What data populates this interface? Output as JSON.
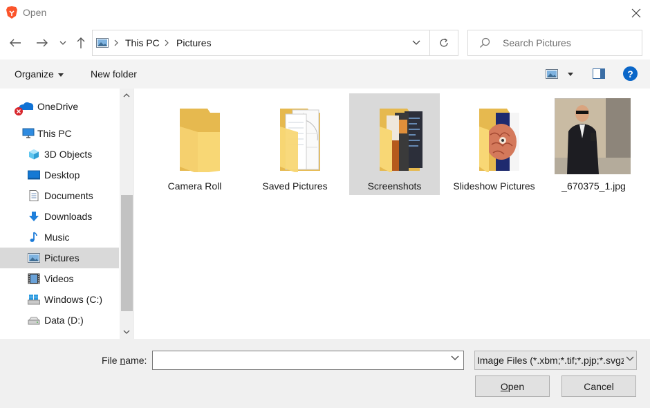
{
  "window": {
    "title": "Open",
    "close_icon": "close-icon",
    "app_icon": "brave-lion-icon"
  },
  "nav": {
    "back_icon": "arrow-left-icon",
    "forward_icon": "arrow-right-icon",
    "recent_icon": "chevron-down-icon",
    "up_icon": "arrow-up-icon",
    "breadcrumb": [
      "This PC",
      "Pictures"
    ],
    "refresh_icon": "refresh-icon",
    "search_placeholder": "Search Pictures"
  },
  "toolbar": {
    "organize": "Organize",
    "new_folder": "New folder",
    "help": "?"
  },
  "sidebar": {
    "items": [
      {
        "label": "OneDrive",
        "icon": "onedrive-error-icon"
      },
      {
        "label": "This PC",
        "icon": "computer-icon"
      },
      {
        "label": "3D Objects",
        "icon": "3d-objects-icon"
      },
      {
        "label": "Desktop",
        "icon": "desktop-icon"
      },
      {
        "label": "Documents",
        "icon": "documents-icon"
      },
      {
        "label": "Downloads",
        "icon": "download-arrow-icon"
      },
      {
        "label": "Music",
        "icon": "music-note-icon"
      },
      {
        "label": "Pictures",
        "icon": "pictures-icon",
        "selected": true
      },
      {
        "label": "Videos",
        "icon": "film-icon"
      },
      {
        "label": "Windows (C:)",
        "icon": "windows-drive-icon"
      },
      {
        "label": "Data (D:)",
        "icon": "drive-icon"
      }
    ]
  },
  "files": [
    {
      "name": "Camera Roll",
      "kind": "folder"
    },
    {
      "name": "Saved Pictures",
      "kind": "folder"
    },
    {
      "name": "Screenshots",
      "kind": "folder",
      "selected": true
    },
    {
      "name": "Slideshow Pictures",
      "kind": "folder"
    },
    {
      "name": "_670375_1.jpg",
      "kind": "image"
    }
  ],
  "bottom": {
    "file_name_label_prefix": "File ",
    "file_name_label_mnemonic": "n",
    "file_name_label_suffix": "ame:",
    "file_name_value": "",
    "filter_value": "Image Files (*.xbm;*.tif;*.pjp;*.svgz;*.jpg;*.jpeg;*.ico;*.tiff;*.gif;*.svg;*.jfif;*.webp;*.png;*.bmp;*.pjpeg;*.avif)",
    "open_mnemonic": "O",
    "open_rest": "pen",
    "cancel": "Cancel"
  },
  "colors": {
    "accent": "#0078d7",
    "folder": "#f8d775",
    "selected_bg": "#d9d9d9"
  }
}
